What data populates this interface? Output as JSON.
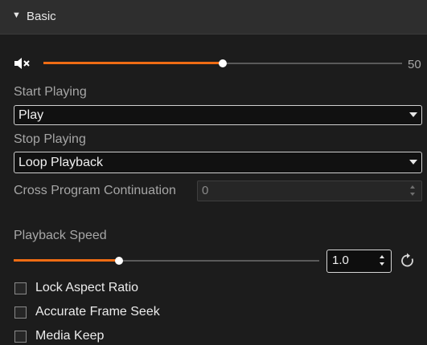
{
  "section": {
    "title": "Basic",
    "caret": "▼"
  },
  "volume": {
    "value": "50",
    "level_percent": 50,
    "icon": "speaker-muted-icon"
  },
  "start_playing": {
    "label": "Start Playing",
    "value": "Play"
  },
  "stop_playing": {
    "label": "Stop Playing",
    "value": "Loop Playback"
  },
  "cross_program": {
    "label": "Cross Program Continuation",
    "value": "0"
  },
  "playback_speed": {
    "label": "Playback Speed",
    "value": "1.0",
    "reset_icon": "reset-icon"
  },
  "checkboxes": [
    {
      "label": "Lock Aspect Ratio",
      "checked": false
    },
    {
      "label": "Accurate Frame Seek",
      "checked": false
    },
    {
      "label": "Media Keep",
      "checked": false
    }
  ],
  "colors": {
    "accent": "#ef6c14",
    "background": "#1c1c1c",
    "header": "#2e2e2e"
  }
}
